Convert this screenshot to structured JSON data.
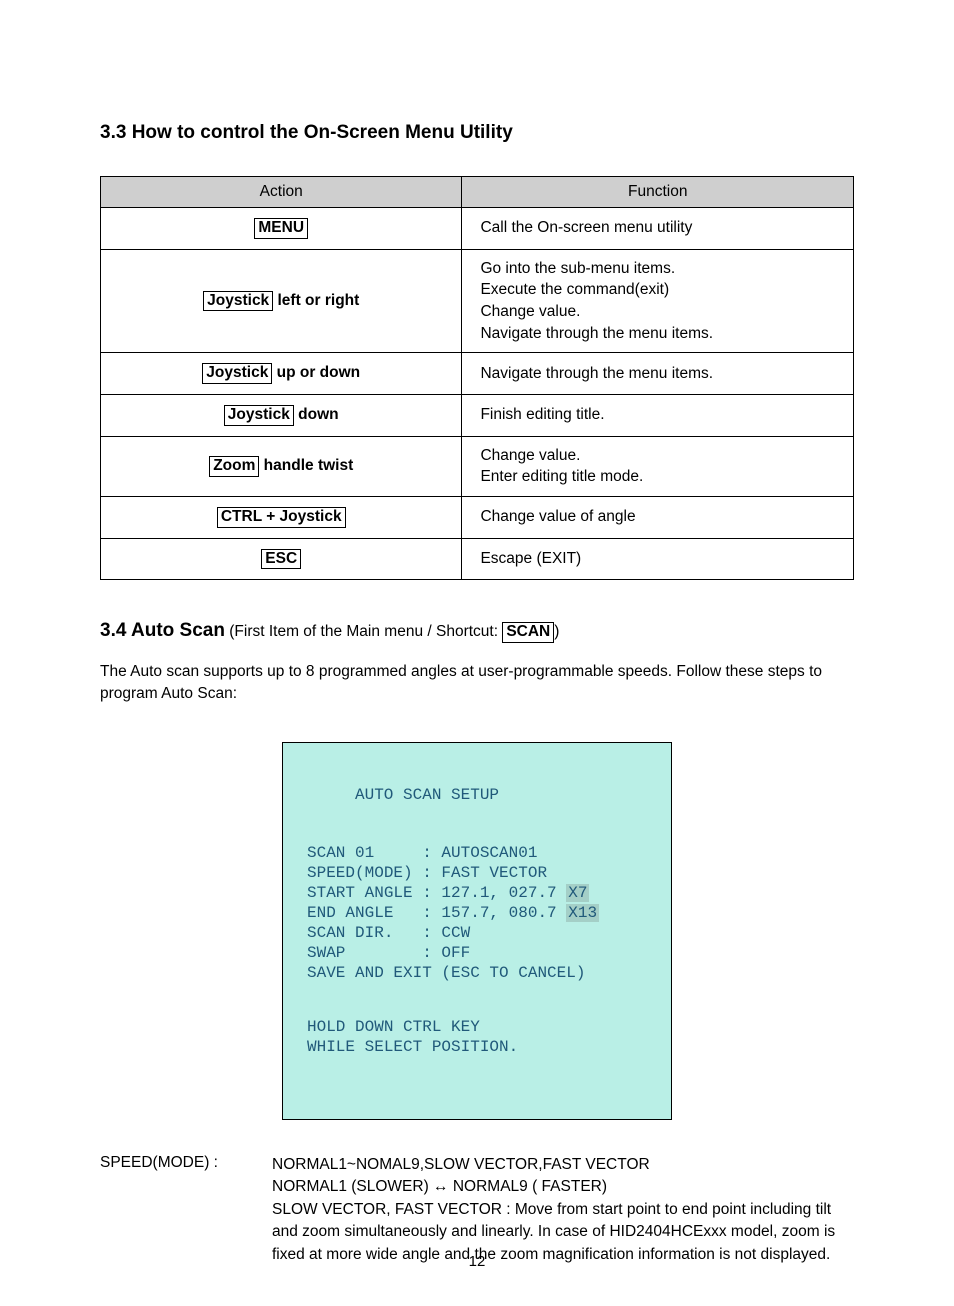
{
  "heading33": "3.3 How to control the On-Screen Menu Utility",
  "table": {
    "head": {
      "action": "Action",
      "function": "Function"
    },
    "rows": [
      {
        "action_keys": [
          "MENU"
        ],
        "action_plain": "",
        "func_lines": [
          "Call the On-screen menu utility"
        ]
      },
      {
        "action_keys": [
          "Joystick"
        ],
        "action_plain": " left or right",
        "func_lines": [
          "Go into the sub-menu items.",
          "Execute the command(exit)",
          "Change value.",
          "Navigate through the menu items."
        ]
      },
      {
        "action_keys": [
          "Joystick"
        ],
        "action_plain": " up or down",
        "func_lines": [
          "Navigate through the menu items."
        ]
      },
      {
        "action_keys": [
          "Joystick"
        ],
        "action_plain": " down",
        "func_lines": [
          "Finish editing title."
        ]
      },
      {
        "action_keys": [
          "Zoom"
        ],
        "action_plain": " handle twist",
        "func_lines": [
          "Change value.",
          "Enter editing title mode."
        ]
      },
      {
        "action_keys": [
          "CTRL + Joystick"
        ],
        "action_plain": "",
        "func_lines": [
          "Change value of angle"
        ]
      },
      {
        "action_keys": [
          "ESC"
        ],
        "action_plain": "",
        "func_lines": [
          "Escape (EXIT)"
        ]
      }
    ]
  },
  "sect34": {
    "title": "3.4 Auto Scan",
    "note_before": "  (First Item of the Main menu / Shortcut: ",
    "note_key": "SCAN",
    "note_after": ")",
    "para": "The Auto scan supports up to 8 programmed angles at user-programmable speeds.  Follow these steps to program Auto Scan:"
  },
  "osd": {
    "title": "AUTO SCAN SETUP",
    "lines": [
      "SCAN 01     : AUTOSCAN01",
      "SPEED(MODE) : FAST VECTOR",
      "START ANGLE : 127.1, 027.7 ",
      "END ANGLE   : 157.7, 080.7 ",
      "SCAN DIR.   : CCW",
      "SWAP        : OFF",
      "SAVE AND EXIT (ESC TO CANCEL)"
    ],
    "hl_start": "X7",
    "hl_end": "X13",
    "hint": [
      "HOLD DOWN CTRL KEY",
      "WHILE SELECT POSITION."
    ]
  },
  "speed": {
    "label": "SPEED(MODE) :",
    "body": [
      "NORMAL1~NOMAL9,SLOW VECTOR,FAST VECTOR",
      "NORMAL1 (SLOWER) ↔ NORMAL9 ( FASTER)",
      "SLOW VECTOR, FAST VECTOR : Move from start point to end point including tilt and zoom  simultaneously and linearly. In case of HID2404HCExxx model, zoom is fixed at more wide angle and the zoom magnification information is not displayed."
    ]
  },
  "page_num": "12"
}
